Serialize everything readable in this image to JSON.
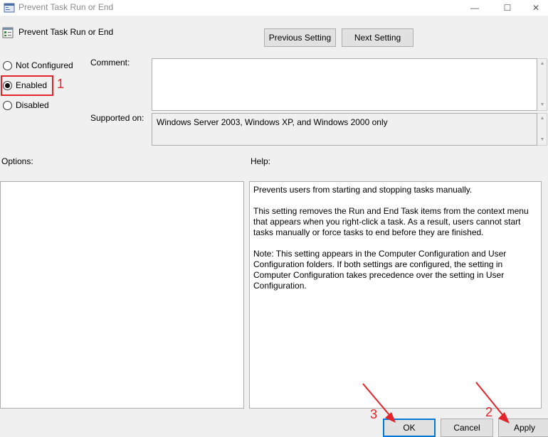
{
  "window": {
    "title": "Prevent Task Run or End",
    "controls": {
      "minimize": "—",
      "maximize": "☐",
      "close": "✕"
    }
  },
  "header": {
    "policy_title": "Prevent Task Run or End",
    "prev_label": "Previous Setting",
    "next_label": "Next Setting"
  },
  "state": {
    "options": [
      {
        "label": "Not Configured",
        "checked": false
      },
      {
        "label": "Enabled",
        "checked": true
      },
      {
        "label": "Disabled",
        "checked": false
      }
    ]
  },
  "comment": {
    "label": "Comment:",
    "value": ""
  },
  "supported": {
    "label": "Supported on:",
    "value": "Windows Server 2003, Windows XP, and Windows 2000 only"
  },
  "options_section": {
    "label": "Options:"
  },
  "help": {
    "label": "Help:",
    "paragraphs": [
      "Prevents users from starting and stopping tasks manually.",
      "This setting removes the Run and End Task items from the context menu that appears when you right-click a task. As a result, users cannot start tasks manually or force tasks to end before they are finished.",
      "Note: This setting appears in the Computer Configuration and User Configuration folders. If both settings are configured, the setting in Computer Configuration takes precedence over the setting in User Configuration."
    ]
  },
  "footer": {
    "ok_label": "OK",
    "cancel_label": "Cancel",
    "apply_label": "Apply"
  },
  "annotations": {
    "step1": "1",
    "step2": "2",
    "step3": "3",
    "color": "#e3242b"
  },
  "icons": {
    "window": "policy-window-icon",
    "policy": "policy-setting-icon",
    "scroll_up": "▲",
    "scroll_down": "▼"
  },
  "colors": {
    "accent": "#0078d7",
    "annotation": "#e3242b",
    "background": "#f0f0f0"
  }
}
